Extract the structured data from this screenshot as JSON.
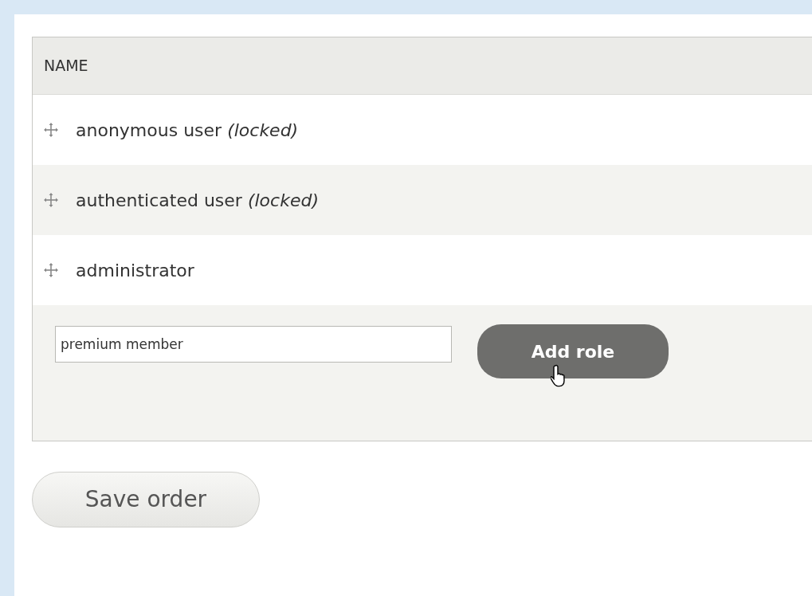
{
  "table": {
    "columns": [
      "NAME"
    ],
    "rows": [
      {
        "name": "anonymous user *(locked)*"
      },
      {
        "name": "authenticated user *(locked)*"
      },
      {
        "name": "administrator"
      }
    ],
    "new_role": {
      "value": "premium member",
      "button": "Add role"
    }
  },
  "buttons": [
    "Save order"
  ]
}
